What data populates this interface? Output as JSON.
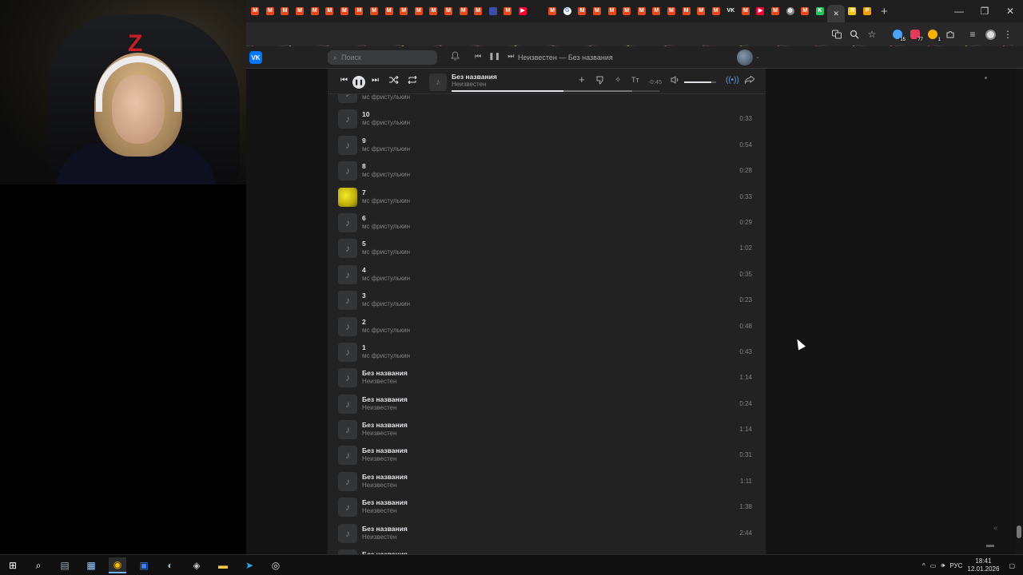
{
  "browser": {
    "tabs": [
      {
        "icon": "mc-icon",
        "color": "#e24a1e",
        "glyph": "M"
      },
      {
        "icon": "mc-icon",
        "color": "#e24a1e",
        "glyph": "M"
      },
      {
        "icon": "mc-icon",
        "color": "#e24a1e",
        "glyph": "M"
      },
      {
        "icon": "mc-icon",
        "color": "#e24a1e",
        "glyph": "M"
      },
      {
        "icon": "mc-icon",
        "color": "#e24a1e",
        "glyph": "M"
      },
      {
        "icon": "mc-icon",
        "color": "#e24a1e",
        "glyph": "M"
      },
      {
        "icon": "mc-icon",
        "color": "#e24a1e",
        "glyph": "M"
      },
      {
        "icon": "mc-icon",
        "color": "#e24a1e",
        "glyph": "M"
      },
      {
        "icon": "mc-icon",
        "color": "#e24a1e",
        "glyph": "M"
      },
      {
        "icon": "mc-icon",
        "color": "#e24a1e",
        "glyph": "M"
      },
      {
        "icon": "mc-icon",
        "color": "#e24a1e",
        "glyph": "M"
      },
      {
        "icon": "mc-icon",
        "color": "#e24a1e",
        "glyph": "M"
      },
      {
        "icon": "mc-icon",
        "color": "#e24a1e",
        "glyph": "M"
      },
      {
        "icon": "mc-icon",
        "color": "#e24a1e",
        "glyph": "M"
      },
      {
        "icon": "mc-icon",
        "color": "#e24a1e",
        "glyph": "M"
      },
      {
        "icon": "mc-icon",
        "color": "#e24a1e",
        "glyph": "M"
      },
      {
        "icon": "doc-icon",
        "color": "#3b4ea8",
        "glyph": ""
      },
      {
        "icon": "mc-icon",
        "color": "#e24a1e",
        "glyph": "M"
      },
      {
        "icon": "youtube-icon",
        "color": "#ff0033",
        "glyph": "▶"
      },
      {
        "icon": "blank-icon",
        "color": "#1f1f1f",
        "glyph": ""
      },
      {
        "icon": "mc-icon",
        "color": "#e24a1e",
        "glyph": "M"
      },
      {
        "icon": "google-icon",
        "color": "#ffffff",
        "glyph": "G"
      },
      {
        "icon": "mc-icon",
        "color": "#e24a1e",
        "glyph": "M"
      },
      {
        "icon": "mc-icon",
        "color": "#e24a1e",
        "glyph": "M"
      },
      {
        "icon": "mc-icon",
        "color": "#e24a1e",
        "glyph": "M"
      },
      {
        "icon": "mc-icon",
        "color": "#e24a1e",
        "glyph": "M"
      },
      {
        "icon": "mc-icon",
        "color": "#e24a1e",
        "glyph": "M"
      },
      {
        "icon": "mc-icon",
        "color": "#e24a1e",
        "glyph": "M"
      },
      {
        "icon": "mc-icon",
        "color": "#e24a1e",
        "glyph": "M"
      },
      {
        "icon": "mc-icon",
        "color": "#e24a1e",
        "glyph": "M"
      },
      {
        "icon": "mc-icon",
        "color": "#e24a1e",
        "glyph": "M"
      },
      {
        "icon": "mc-icon",
        "color": "#e24a1e",
        "glyph": "M"
      },
      {
        "icon": "vk-text-icon",
        "color": "#1f1f1f",
        "glyph": "VK"
      },
      {
        "icon": "mc-icon",
        "color": "#e24a1e",
        "glyph": "M"
      },
      {
        "icon": "youtube-icon",
        "color": "#ff0033",
        "glyph": "▶"
      },
      {
        "icon": "mc-icon",
        "color": "#e24a1e",
        "glyph": "M"
      },
      {
        "icon": "globe-icon",
        "color": "#888888",
        "glyph": "◍"
      },
      {
        "icon": "mc-icon",
        "color": "#e24a1e",
        "glyph": "M"
      },
      {
        "icon": "kinopoisk-icon",
        "color": "#22c55e",
        "glyph": "K"
      }
    ],
    "active_tab_close": "✕",
    "tabs_after": [
      {
        "icon": "yellow-ext-icon",
        "color": "#f0c419",
        "glyph": "Я"
      },
      {
        "icon": "orange-p-icon",
        "color": "#f59e0b",
        "glyph": "P"
      }
    ],
    "new_tab": "+",
    "window_controls": [
      "—",
      "❐",
      "✕"
    ],
    "ext_badges": {
      "ext1": "15",
      "ext2": "77",
      "ext3": "1"
    }
  },
  "vk": {
    "logo": "VK",
    "search_placeholder": "Поиск",
    "now_playing_header": "Неизвестен — Без названия"
  },
  "player": {
    "title": "Без названия",
    "artist": "Неизвестен",
    "time": "-0:45",
    "progress": 0.54,
    "buffered": 0.87,
    "volume": 0.85
  },
  "tracks": [
    {
      "title": "",
      "artist": "мс фристулькин",
      "duration": "",
      "cover": "note",
      "partial": true
    },
    {
      "title": "10",
      "artist": "мс фристулькин",
      "duration": "0:33",
      "cover": "note"
    },
    {
      "title": "9",
      "artist": "мс фристулькин",
      "duration": "0:54",
      "cover": "note"
    },
    {
      "title": "8",
      "artist": "мс фристулькин",
      "duration": "0:28",
      "cover": "note"
    },
    {
      "title": "7",
      "artist": "мс фристулькин",
      "duration": "0:33",
      "cover": "yellow"
    },
    {
      "title": "6",
      "artist": "мс фристулькин",
      "duration": "0:29",
      "cover": "note"
    },
    {
      "title": "5",
      "artist": "мс фристулькин",
      "duration": "1:02",
      "cover": "note"
    },
    {
      "title": "4",
      "artist": "мс фристулькин",
      "duration": "0:35",
      "cover": "note"
    },
    {
      "title": "3",
      "artist": "мс фристулькин",
      "duration": "0:23",
      "cover": "note"
    },
    {
      "title": "2",
      "artist": "мс фристулькин",
      "duration": "0:48",
      "cover": "note"
    },
    {
      "title": "1",
      "artist": "мс фристулькин",
      "duration": "0:43",
      "cover": "note"
    },
    {
      "title": "Без названия",
      "artist": "Неизвестен",
      "duration": "1:14",
      "cover": "note"
    },
    {
      "title": "Без названия",
      "artist": "Неизвестен",
      "duration": "0:24",
      "cover": "note"
    },
    {
      "title": "Без названия",
      "artist": "Неизвестен",
      "duration": "1:14",
      "cover": "note"
    },
    {
      "title": "Без названия",
      "artist": "Неизвестен",
      "duration": "0:31",
      "cover": "note"
    },
    {
      "title": "Без названия",
      "artist": "Неизвестен",
      "duration": "1:11",
      "cover": "note"
    },
    {
      "title": "Без названия",
      "artist": "Неизвестен",
      "duration": "1:38",
      "cover": "note"
    },
    {
      "title": "Без названия",
      "artist": "Неизвестен",
      "duration": "2:44",
      "cover": "note"
    },
    {
      "title": "Без названия",
      "artist": "",
      "duration": "",
      "cover": "note",
      "partial": true
    }
  ],
  "taskbar": {
    "apps": [
      "windows-start-icon",
      "search-icon",
      "file-explorer-icon",
      "calculator-icon",
      "chrome-icon",
      "app-icon",
      "steam-icon",
      "browser-icon",
      "folder-icon",
      "telegram-icon",
      "obs-icon"
    ],
    "lang": "РУС",
    "time": "18:41",
    "date": "12.01.2026"
  }
}
